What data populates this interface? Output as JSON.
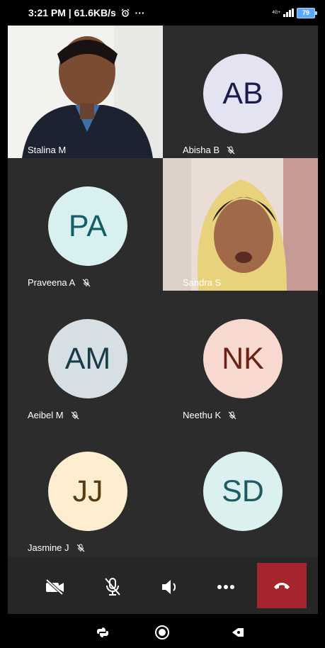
{
  "status_bar": {
    "time_speed": "3:21 PM | 61.6KB/s",
    "more": "···",
    "network_label": "4G+",
    "battery": "79"
  },
  "participants": [
    {
      "name": "Stalina M",
      "initials": "",
      "video": true,
      "muted": false
    },
    {
      "name": "Abisha B",
      "initials": "AB",
      "video": false,
      "muted": true,
      "avatar_bg": "#e3e3f2",
      "initials_color": "#1b1b4d"
    },
    {
      "name": "Praveena A",
      "initials": "PA",
      "video": false,
      "muted": true,
      "avatar_bg": "#d8f0ef",
      "initials_color": "#135d64"
    },
    {
      "name": "Sandra S",
      "initials": "",
      "video": true,
      "muted": false
    },
    {
      "name": "Aeibel M",
      "initials": "AM",
      "video": false,
      "muted": true,
      "avatar_bg": "#d5dfe4",
      "initials_color": "#183b48"
    },
    {
      "name": "Neethu K",
      "initials": "NK",
      "video": false,
      "muted": true,
      "avatar_bg": "#f8d9d0",
      "initials_color": "#6b2116"
    },
    {
      "name": "Jasmine J",
      "initials": "JJ",
      "video": false,
      "muted": true,
      "avatar_bg": "#fdeecf",
      "initials_color": "#5a3b10"
    },
    {
      "name": "",
      "initials": "SD",
      "video": false,
      "muted": false,
      "avatar_bg": "#dbf1f0",
      "initials_color": "#1f5b60"
    }
  ],
  "controls": {
    "camera": "camera-off-icon",
    "mic": "mic-off-icon",
    "speaker": "speaker-icon",
    "more": "more-options-icon",
    "end_call": "end-call-icon",
    "end_call_color": "#a4262c"
  },
  "nav_bar": {
    "back": "back-icon",
    "home": "home-icon",
    "recents": "recents-icon"
  }
}
